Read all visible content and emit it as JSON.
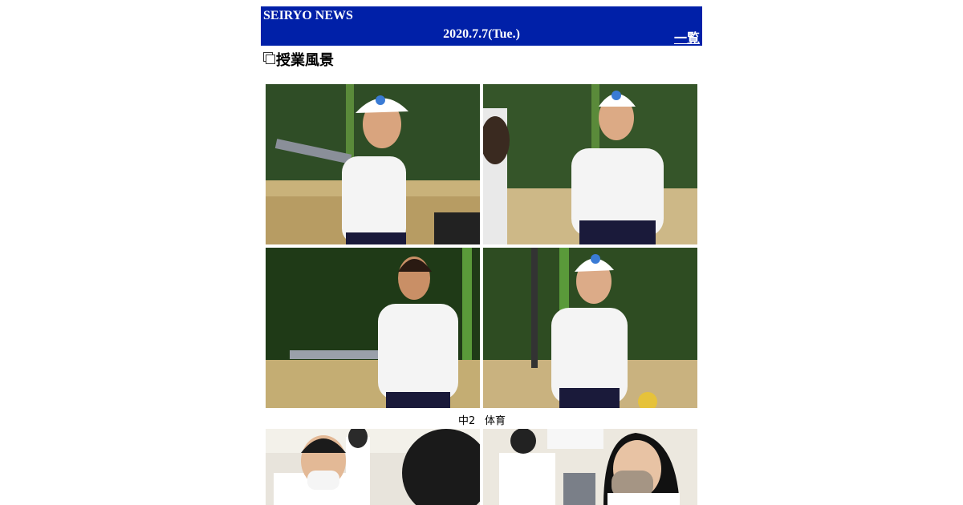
{
  "header": {
    "site_name": "SEIRYO NEWS",
    "date": "2020.7.7(Tue.)",
    "list_link": "一覧"
  },
  "article": {
    "title": "授業風景",
    "title_icon": "copy-icon",
    "photo_groups": [
      {
        "caption_left": "中2",
        "caption_right": "体育",
        "photos": [
          {
            "name": "softball-batting-girl-1",
            "icon": "photo"
          },
          {
            "name": "softball-laughing-girl",
            "icon": "photo"
          },
          {
            "name": "softball-batting-girl-2",
            "icon": "photo"
          },
          {
            "name": "softball-smiling-girl",
            "icon": "photo"
          }
        ]
      },
      {
        "photos": [
          {
            "name": "classroom-boy-masked",
            "icon": "photo"
          },
          {
            "name": "classroom-girl-masked",
            "icon": "photo"
          }
        ]
      }
    ]
  },
  "colors": {
    "header_bg": "#0020a8",
    "header_text": "#ffffff",
    "text": "#000000"
  }
}
